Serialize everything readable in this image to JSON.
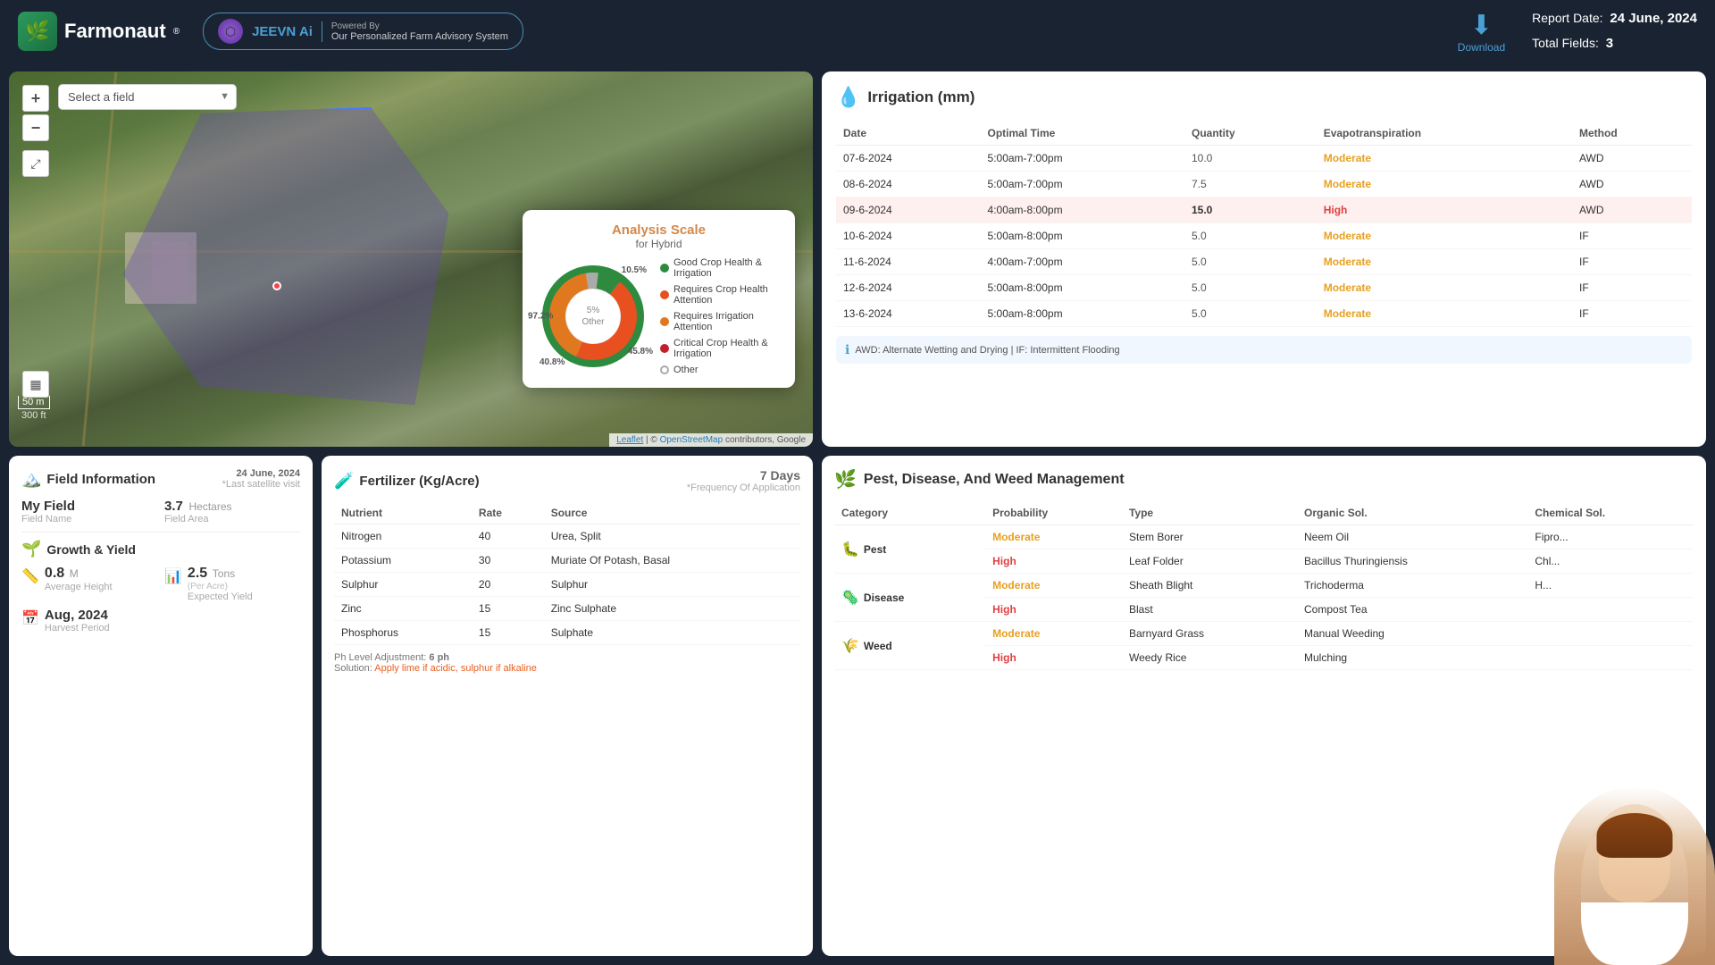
{
  "header": {
    "logo_text": "Farmonaut",
    "reg_symbol": "®",
    "jeevn_text": "JEEVN Ai",
    "powered_by": "Powered By",
    "advisory_text": "Our Personalized Farm Advisory System",
    "download_label": "Download",
    "report_date_label": "Report Date:",
    "report_date": "24 June, 2024",
    "total_fields_label": "Total Fields:",
    "total_fields": "3"
  },
  "map": {
    "field_select_placeholder": "Select a field",
    "zoom_in": "+",
    "zoom_out": "−",
    "scale_m": "50 m",
    "scale_ft": "300 ft",
    "attribution": "Leaflet | © OpenStreetMap contributors, Google"
  },
  "analysis_scale": {
    "title": "Analysis Scale",
    "subtitle": "for Hybrid",
    "label_97": "97.2%",
    "label_10": "10.5%",
    "label_45": "45.8%",
    "label_40": "40.8%",
    "center_label": "5%\nOther",
    "legend": [
      {
        "color": "#2d8a3e",
        "text": "Good Crop Health & Irrigation"
      },
      {
        "color": "#e85020",
        "text": "Requires Crop Health Attention"
      },
      {
        "color": "#e07820",
        "text": "Requires Irrigation Attention"
      },
      {
        "color": "#c0202a",
        "text": "Critical Crop Health & Irrigation"
      },
      {
        "color": null,
        "text": "Other"
      }
    ]
  },
  "irrigation": {
    "title": "Irrigation (mm)",
    "icon": "💧",
    "columns": [
      "Date",
      "Optimal Time",
      "Quantity",
      "Evapotranspiration",
      "Method"
    ],
    "rows": [
      {
        "date": "07-6-2024",
        "time": "5:00am-7:00pm",
        "quantity": "10.0",
        "evap": "Moderate",
        "method": "AWD",
        "highlight": false
      },
      {
        "date": "08-6-2024",
        "time": "5:00am-7:00pm",
        "quantity": "7.5",
        "evap": "Moderate",
        "method": "AWD",
        "highlight": false
      },
      {
        "date": "09-6-2024",
        "time": "4:00am-8:00pm",
        "quantity": "15.0",
        "evap": "High",
        "method": "AWD",
        "highlight": true
      },
      {
        "date": "10-6-2024",
        "time": "5:00am-8:00pm",
        "quantity": "5.0",
        "evap": "Moderate",
        "method": "IF",
        "highlight": false
      },
      {
        "date": "11-6-2024",
        "time": "4:00am-7:00pm",
        "quantity": "5.0",
        "evap": "Moderate",
        "method": "IF",
        "highlight": false
      },
      {
        "date": "12-6-2024",
        "time": "5:00am-8:00pm",
        "quantity": "5.0",
        "evap": "Moderate",
        "method": "IF",
        "highlight": false
      },
      {
        "date": "13-6-2024",
        "time": "5:00am-8:00pm",
        "quantity": "5.0",
        "evap": "Moderate",
        "method": "IF",
        "highlight": false
      }
    ],
    "note": "AWD: Alternate Wetting and Drying | IF: Intermittent Flooding"
  },
  "field_info": {
    "title": "Field Information",
    "icon": "🏔️",
    "date": "24 June, 2024",
    "last_satellite": "*Last satellite visit",
    "field_name_label": "Field Name",
    "field_name": "My Field",
    "field_area_label": "Field Area",
    "field_area_value": "3.7",
    "field_area_unit": "Hectares",
    "growth_title": "Growth & Yield",
    "growth_icon": "🌱",
    "avg_height_value": "0.8",
    "avg_height_unit": "M",
    "avg_height_label": "Average Height",
    "expected_yield_value": "2.5",
    "expected_yield_unit": "Tons",
    "expected_yield_sub": "(Per Acre)",
    "expected_yield_label": "Expected Yield",
    "harvest_value": "Aug, 2024",
    "harvest_label": "Harvest Period"
  },
  "fertilizer": {
    "title": "Fertilizer (Kg/Acre)",
    "icon": "🧪",
    "frequency": "7 Days",
    "frequency_sub": "*Frequency Of Application",
    "columns": [
      "Nutrient",
      "Rate",
      "Source"
    ],
    "rows": [
      {
        "nutrient": "Nitrogen",
        "rate": "40",
        "source": "Urea, Split"
      },
      {
        "nutrient": "Potassium",
        "rate": "30",
        "source": "Muriate Of Potash, Basal"
      },
      {
        "nutrient": "Sulphur",
        "rate": "20",
        "source": "Sulphur"
      },
      {
        "nutrient": "Zinc",
        "rate": "15",
        "source": "Zinc Sulphate"
      },
      {
        "nutrient": "Phosphorus",
        "rate": "15",
        "source": "Sulphate"
      }
    ],
    "ph_note": "Ph Level Adjustment: ",
    "ph_value": "6 ph",
    "solution_label": "Solution: ",
    "solution_text": "Apply lime if acidic, sulphur if alkaline"
  },
  "pest": {
    "title": "Pest, Disease, And Weed Management",
    "icon": "🌿",
    "columns": [
      "Category",
      "Probability",
      "Type",
      "Organic Sol.",
      "Chemical Sol."
    ],
    "rows": [
      {
        "category": "Pest",
        "cat_icon": "🐛",
        "probability": "Moderate",
        "prob_class": "moderate",
        "type": "Stem Borer",
        "organic": "Neem Oil",
        "chemical": "Fipro..."
      },
      {
        "category": "",
        "cat_icon": "",
        "probability": "High",
        "prob_class": "high",
        "type": "Leaf Folder",
        "organic": "Bacillus Thuringiensis",
        "chemical": "Chl..."
      },
      {
        "category": "Disease",
        "cat_icon": "🦠",
        "probability": "Moderate",
        "prob_class": "moderate",
        "type": "Sheath Blight",
        "organic": "Trichoderma",
        "chemical": "H..."
      },
      {
        "category": "",
        "cat_icon": "",
        "probability": "High",
        "prob_class": "high",
        "type": "Blast",
        "organic": "Compost Tea",
        "chemical": ""
      },
      {
        "category": "Weed",
        "cat_icon": "🌾",
        "probability": "Moderate",
        "prob_class": "moderate",
        "type": "Barnyard Grass",
        "organic": "Manual Weeding",
        "chemical": ""
      },
      {
        "category": "",
        "cat_icon": "",
        "probability": "High",
        "prob_class": "high",
        "type": "Weedy Rice",
        "organic": "Mulching",
        "chemical": ""
      }
    ]
  }
}
